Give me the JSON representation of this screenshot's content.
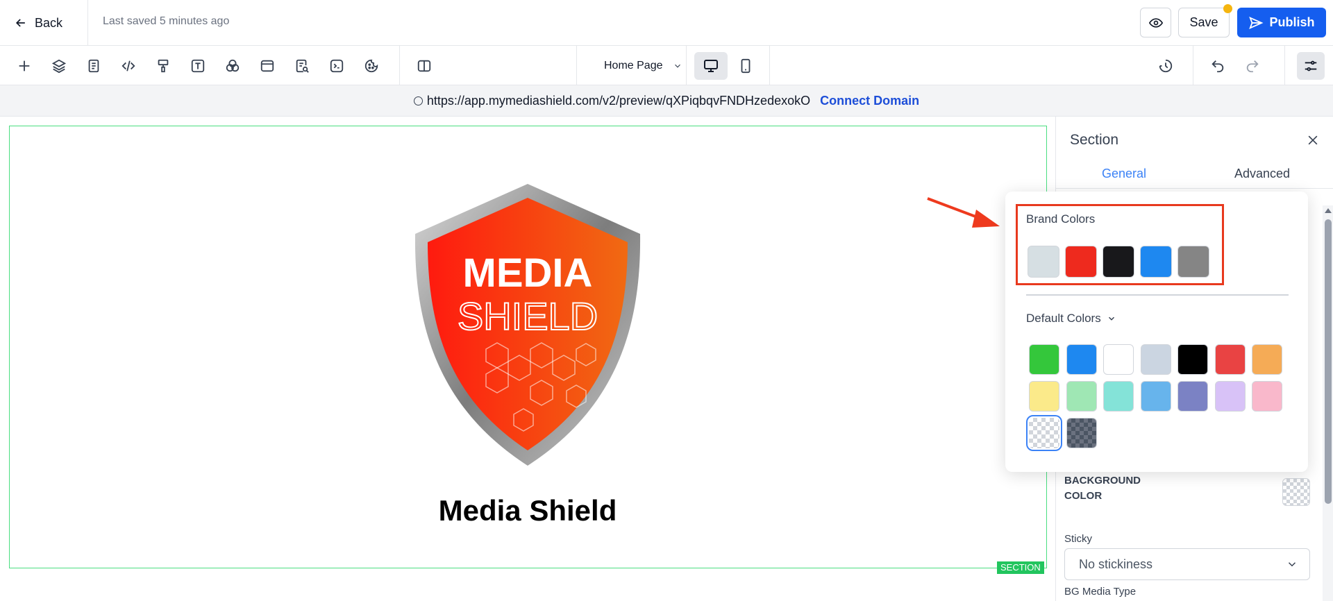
{
  "header": {
    "back_label": "Back",
    "last_saved": "Last saved 5 minutes ago",
    "save_label": "Save",
    "publish_label": "Publish"
  },
  "toolbar": {
    "page_select": "Home Page"
  },
  "urlbar": {
    "url": "https://app.mymediashield.com/v2/preview/qXPiqbqvFNDHzedexokO",
    "connect_domain": "Connect Domain"
  },
  "canvas": {
    "logo_top_text": "MEDIA",
    "logo_bottom_text": "SHIELD",
    "title": "Media Shield",
    "section_tag": "SECTION"
  },
  "panel": {
    "title": "Section",
    "tabs": [
      "General",
      "Advanced"
    ],
    "active_tab": "General",
    "background_color_label": "BACKGROUND\nCOLOR",
    "sticky_label": "Sticky",
    "sticky_value": "No stickiness",
    "bg_media_label": "BG Media Type"
  },
  "color_picker": {
    "brand_label": "Brand Colors",
    "brand_colors": [
      "#d6dfe3",
      "#ee2a1e",
      "#18181b",
      "#1e88f0",
      "#858585"
    ],
    "default_label": "Default Colors",
    "default_colors": [
      "#34c73b",
      "#1e88f0",
      "#ffffff",
      "#cbd5e1",
      "#000000",
      "#e94343",
      "#f5ab56",
      "#fbea8a",
      "#9fe7b4",
      "#84e3d8",
      "#67b4ec",
      "#7b82c4",
      "#d8c2f7",
      "#f9b8cb"
    ],
    "special_swatches": [
      "transparent",
      "dark-transparent"
    ],
    "selected": "transparent"
  },
  "colors": {
    "accent": "#155eef",
    "highlight": "#e8391e",
    "section_border": "#4ade80"
  }
}
